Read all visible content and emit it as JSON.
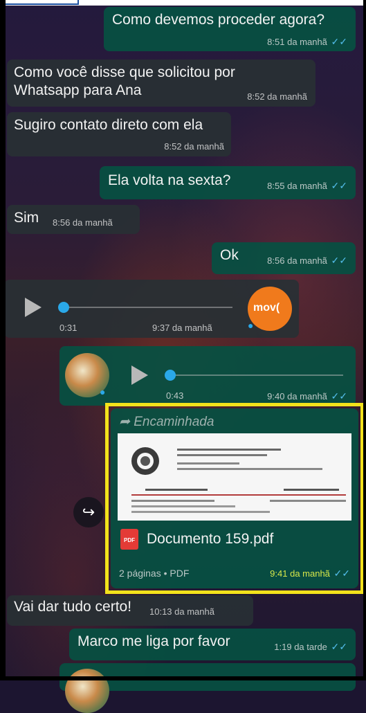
{
  "messages": {
    "m1": {
      "text": "Como devemos proceder agora?",
      "time": "8:51 da manhã"
    },
    "m2": {
      "line1": "Como você disse que solicitou por",
      "line2": "Whatsapp para Ana",
      "time": "8:52 da manhã"
    },
    "m3": {
      "text": "Sugiro contato direto com ela",
      "time": "8:52 da manhã"
    },
    "m4": {
      "text": "Ela volta na sexta?",
      "time": "8:55 da manhã"
    },
    "m5": {
      "text": "Sim",
      "time": "8:56 da manhã"
    },
    "m6": {
      "text": "Ok",
      "time": "8:56 da manhã"
    },
    "voice1": {
      "duration": "0:31",
      "time": "9:37 da manhã",
      "avatar_text": "mov("
    },
    "voice2": {
      "duration": "0:43",
      "time": "9:40 da manhã"
    },
    "doc": {
      "forwarded_label": "Encaminhada",
      "filename": "Documento 159.pdf",
      "meta": "2 páginas • PDF",
      "time": "9:41 da manhã",
      "icon_text": "PDF"
    },
    "m7": {
      "text": "Vai dar tudo certo!",
      "time": "10:13 da manhã"
    },
    "m8": {
      "text": "Marco me liga por favor",
      "time": "1:19 da tarde"
    }
  },
  "icons": {
    "read_ticks": "✓✓",
    "play": "play-icon",
    "mic": "mic-icon",
    "forward": "↪"
  },
  "colors": {
    "incoming_bubble": "#283034",
    "outgoing_bubble": "#065042",
    "read_ticks": "#53bdeb",
    "highlight": "#f3e21b"
  }
}
